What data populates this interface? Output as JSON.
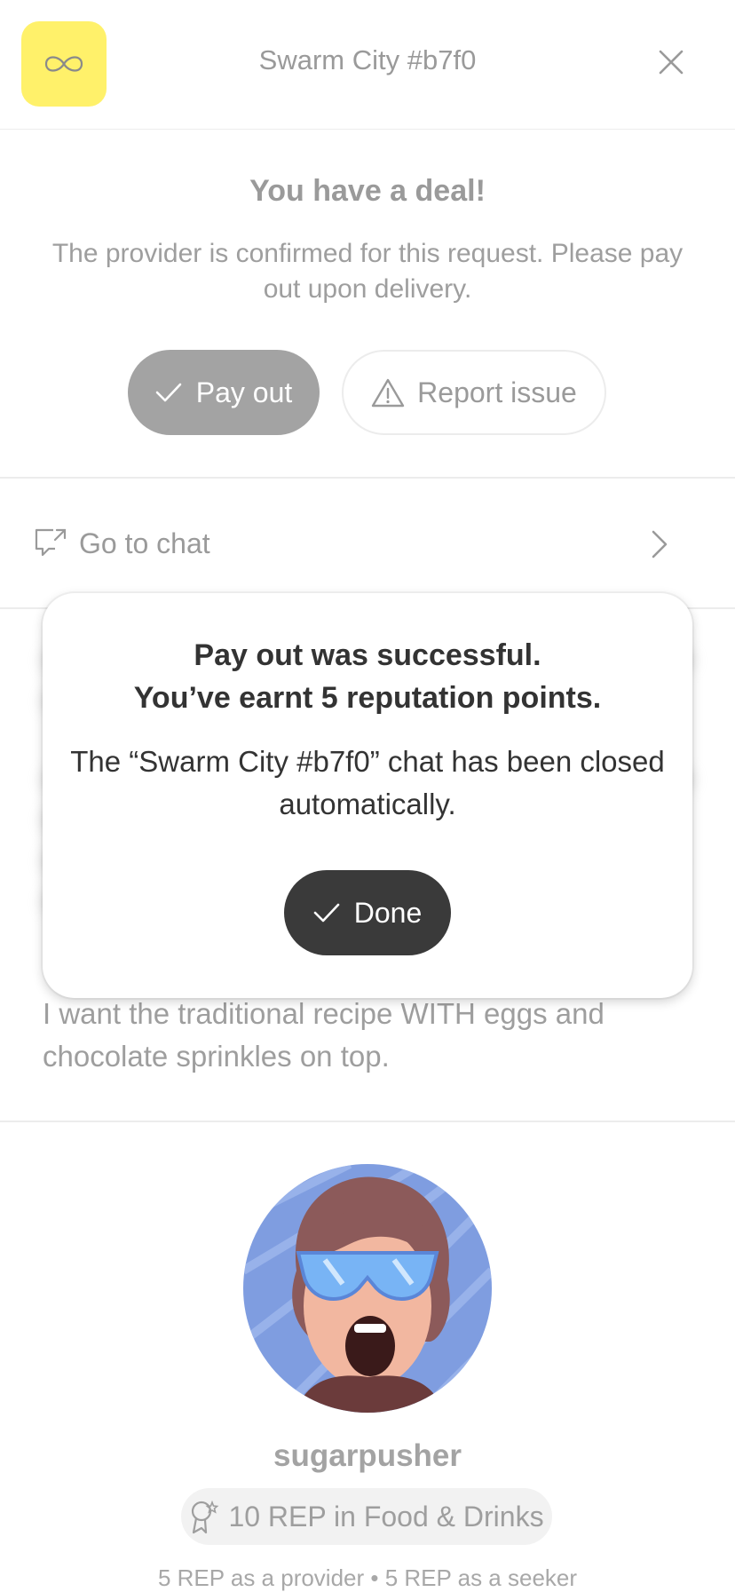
{
  "header": {
    "title": "Swarm City #b7f0",
    "logo_icon": "infinity-icon",
    "close_icon": "close-icon",
    "logo_color": "#fff16a"
  },
  "deal": {
    "title": "You have a deal!",
    "description": "The provider is confirmed for this request. Please pay out upon delivery.",
    "pay_out_label": "Pay out",
    "report_issue_label": "Report issue"
  },
  "chat": {
    "label": "Go to chat"
  },
  "request": {
    "description_visible": "I want the traditional recipe WITH eggs and chocolate sprinkles on top."
  },
  "profile": {
    "username": "sugarpusher",
    "rep_badge": "10 REP in Food & Drinks",
    "rep_summary": "5 REP as a provider • 5 REP as a seeker"
  },
  "modal": {
    "title_line1": "Pay out was successful.",
    "title_line2": "You’ve earnt 5 reputation points.",
    "body": "The “Swarm City #b7f0” chat has been closed automatically.",
    "done_label": "Done",
    "done_color": "#3a3a3a"
  }
}
